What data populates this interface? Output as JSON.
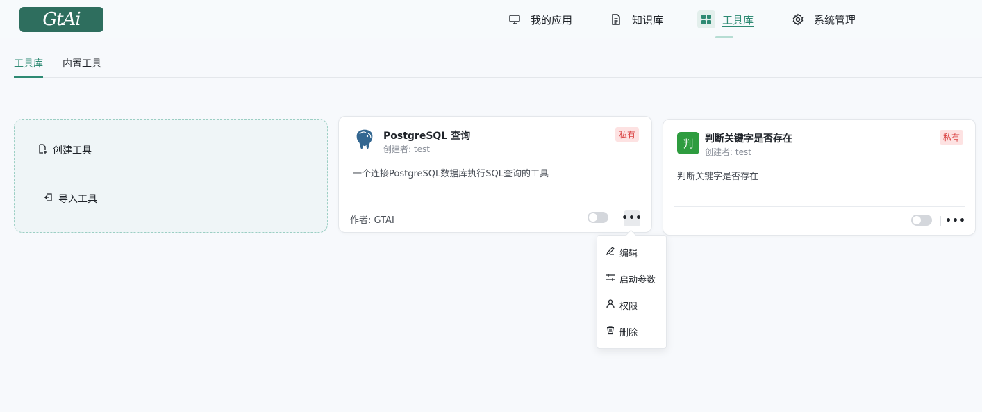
{
  "header": {
    "logo_text": "GtAi",
    "nav": [
      {
        "label": "我的应用",
        "icon": "monitor-icon"
      },
      {
        "label": "知识库",
        "icon": "document-icon"
      },
      {
        "label": "工具库",
        "icon": "grid-icon",
        "active": true
      },
      {
        "label": "系统管理",
        "icon": "gear-icon"
      }
    ]
  },
  "tabs": [
    {
      "label": "工具库",
      "active": true
    },
    {
      "label": "内置工具"
    }
  ],
  "create_card": {
    "create_label": "创建工具",
    "import_label": "导入工具"
  },
  "tools": [
    {
      "title": "PostgreSQL 查询",
      "creator": "创建者: test",
      "badge": "私有",
      "description": "一个连接PostgreSQL数据库执行SQL查询的工具",
      "author": "作者: GTAI",
      "icon": "postgresql-elephant-icon",
      "enabled": false
    },
    {
      "title": "判断关键字是否存在",
      "creator": "创建者: test",
      "badge": "私有",
      "description": "判断关键字是否存在",
      "icon_text": "判",
      "icon_color": "#2e9c3f",
      "enabled": false
    }
  ],
  "dropdown_menu": [
    {
      "label": "编辑",
      "icon": "edit-icon"
    },
    {
      "label": "启动参数",
      "icon": "sliders-icon"
    },
    {
      "label": "权限",
      "icon": "user-icon"
    },
    {
      "label": "删除",
      "icon": "trash-icon"
    }
  ],
  "colors": {
    "accent": "#2e8a73",
    "logo_bg": "#2e6e5e",
    "badge_bg": "#fde2e2",
    "badge_text": "#d94141"
  }
}
